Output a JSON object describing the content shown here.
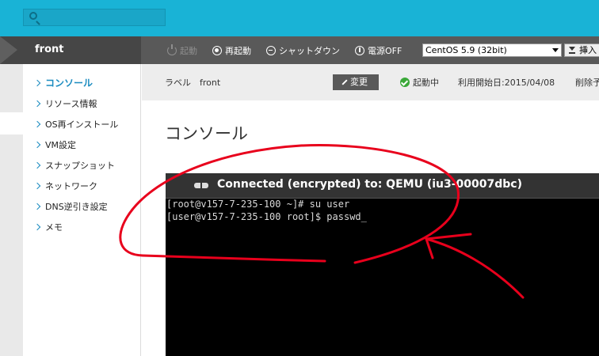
{
  "header": {
    "search": {
      "placeholder": ""
    }
  },
  "server": {
    "name": "front"
  },
  "toolbar": {
    "start_label": "起動",
    "restart_label": "再起動",
    "shutdown_label": "シャットダウン",
    "power_off_label": "電源OFF",
    "os_select": {
      "selected": "CentOS 5.9 (32bit)"
    },
    "insert_label": "挿入"
  },
  "sidebar": {
    "items": [
      {
        "label": "コンソール",
        "active": true
      },
      {
        "label": "リソース情報"
      },
      {
        "label": "OS再インストール"
      },
      {
        "label": "VM設定"
      },
      {
        "label": "スナップショット"
      },
      {
        "label": "ネットワーク"
      },
      {
        "label": "DNS逆引き設定"
      },
      {
        "label": "メモ"
      }
    ]
  },
  "info": {
    "label_text": "ラベル　front",
    "edit_label": "変更",
    "status": "起動中",
    "start_date": "利用開始日:2015/04/08",
    "delete_label": "削除予"
  },
  "main": {
    "title": "コンソール"
  },
  "console": {
    "connection_text": "Connected (encrypted) to: QEMU (iu3-00007dbc)",
    "lines": [
      "[root@v157-7-235-100 ~]# su user",
      "[user@v157-7-235-100 root]$ passwd_"
    ]
  },
  "colors": {
    "topbar": "#19b3d6",
    "toolbar": "#595959",
    "accent": "#1c8cc0",
    "status_ok": "#3aa838",
    "annotation": "#e8001c"
  }
}
